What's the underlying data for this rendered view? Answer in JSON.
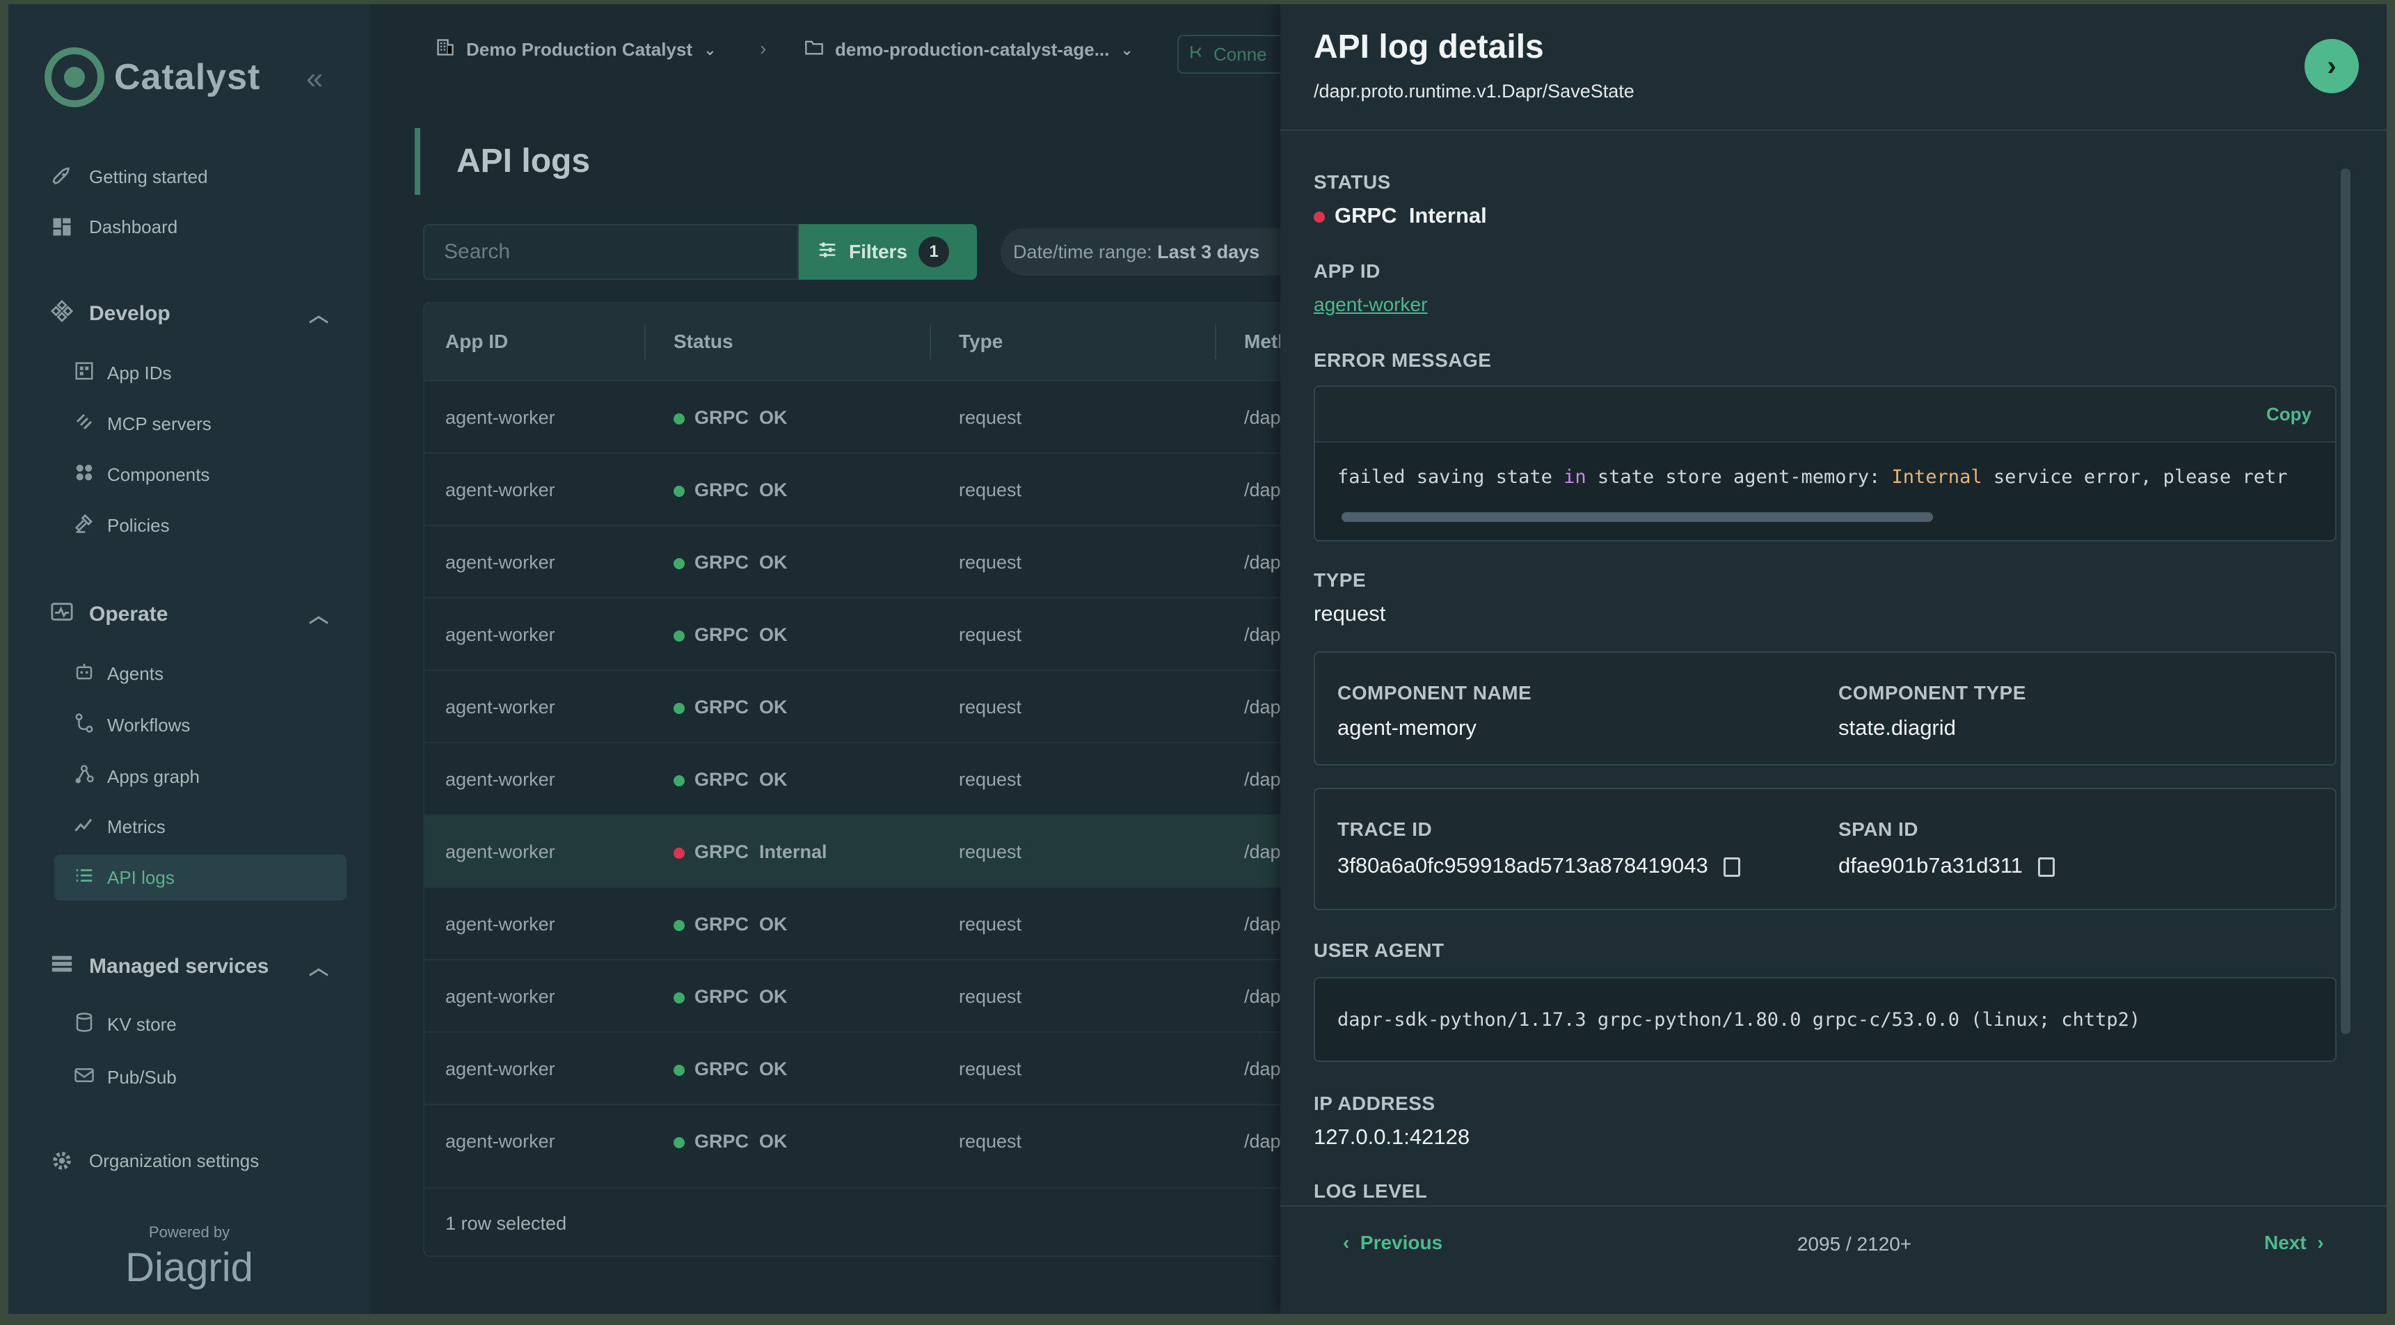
{
  "app": {
    "name": "Catalyst",
    "collapse_icon": "double-chevron-left-icon"
  },
  "sidebar": {
    "top_items": [
      {
        "label": "Getting started",
        "icon": "rocket-icon"
      },
      {
        "label": "Dashboard",
        "icon": "dashboard-icon"
      }
    ],
    "sections": [
      {
        "label": "Develop",
        "items": [
          "App IDs",
          "MCP servers",
          "Components",
          "Policies"
        ]
      },
      {
        "label": "Operate",
        "items": [
          "Agents",
          "Workflows",
          "Apps graph",
          "Metrics",
          "API logs"
        ]
      },
      {
        "label": "Managed services",
        "items": [
          "KV store",
          "Pub/Sub"
        ]
      }
    ],
    "active_item": "API logs",
    "org_settings": "Organization settings",
    "powered_by": "Powered by",
    "brand": "Diagrid"
  },
  "breadcrumb": {
    "org": "Demo Production Catalyst",
    "project": "demo-production-catalyst-age...",
    "connect": "Conne"
  },
  "page": {
    "title": "API logs",
    "search_placeholder": "Search",
    "filters_label": "Filters",
    "filters_count": "1",
    "daterange_label": "Date/time range:",
    "daterange_value": "Last 3 days"
  },
  "table": {
    "columns": [
      "App ID",
      "Status",
      "Type",
      "Meth"
    ],
    "rows": [
      {
        "app_id": "agent-worker",
        "status_code": "GRPC",
        "status": "OK",
        "type": "request",
        "method": "/dapr"
      },
      {
        "app_id": "agent-worker",
        "status_code": "GRPC",
        "status": "OK",
        "type": "request",
        "method": "/dapr"
      },
      {
        "app_id": "agent-worker",
        "status_code": "GRPC",
        "status": "OK",
        "type": "request",
        "method": "/dapr"
      },
      {
        "app_id": "agent-worker",
        "status_code": "GRPC",
        "status": "OK",
        "type": "request",
        "method": "/dapr"
      },
      {
        "app_id": "agent-worker",
        "status_code": "GRPC",
        "status": "OK",
        "type": "request",
        "method": "/dapr"
      },
      {
        "app_id": "agent-worker",
        "status_code": "GRPC",
        "status": "OK",
        "type": "request",
        "method": "/dapr"
      },
      {
        "app_id": "agent-worker",
        "status_code": "GRPC",
        "status": "Internal",
        "type": "request",
        "method": "/dapr"
      },
      {
        "app_id": "agent-worker",
        "status_code": "GRPC",
        "status": "OK",
        "type": "request",
        "method": "/dapr"
      },
      {
        "app_id": "agent-worker",
        "status_code": "GRPC",
        "status": "OK",
        "type": "request",
        "method": "/dapr"
      },
      {
        "app_id": "agent-worker",
        "status_code": "GRPC",
        "status": "OK",
        "type": "request",
        "method": "/dapr"
      },
      {
        "app_id": "agent-worker",
        "status_code": "GRPC",
        "status": "OK",
        "type": "request",
        "method": "/dapr"
      }
    ],
    "selected_index": 6,
    "footer": "1 row selected"
  },
  "colors": {
    "ok": "#3fa96a",
    "error": "#d8364f",
    "accent": "#4fb88d"
  },
  "panel": {
    "title": "API log details",
    "subtitle": "/dapr.proto.runtime.v1.Dapr/SaveState",
    "status_label": "STATUS",
    "status_code": "GRPC",
    "status_value": "Internal",
    "app_id_label": "APP ID",
    "app_id_value": "agent-worker",
    "error_label": "ERROR MESSAGE",
    "copy_label": "Copy",
    "error_parts": {
      "p1": "failed saving state ",
      "kw1": "in",
      "p2": " state store agent-memory: ",
      "kw2": "Internal",
      "p3": " service error, please retr"
    },
    "type_label": "TYPE",
    "type_value": "request",
    "component_name_label": "COMPONENT NAME",
    "component_name_value": "agent-memory",
    "component_type_label": "COMPONENT TYPE",
    "component_type_value": "state.diagrid",
    "trace_id_label": "TRACE ID",
    "trace_id_value": "3f80a6a0fc959918ad5713a878419043",
    "span_id_label": "SPAN ID",
    "span_id_value": "dfae901b7a31d311",
    "user_agent_label": "USER AGENT",
    "user_agent_value": "dapr-sdk-python/1.17.3 grpc-python/1.80.0 grpc-c/53.0.0 (linux; chttp2)",
    "ip_label": "IP ADDRESS",
    "ip_value": "127.0.0.1:42128",
    "log_level_label": "LOG LEVEL",
    "prev_label": "Previous",
    "next_label": "Next",
    "pager": "2095 / 2120+"
  }
}
